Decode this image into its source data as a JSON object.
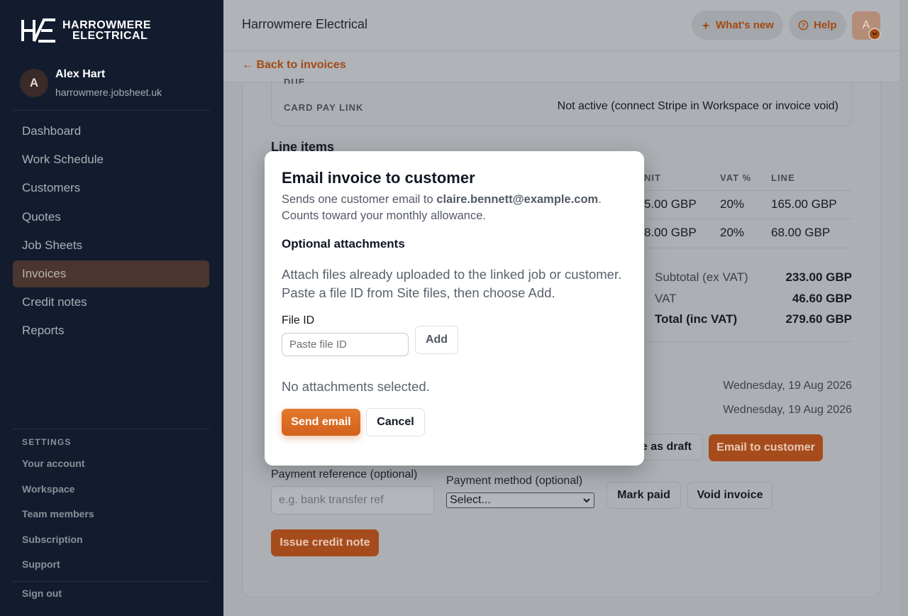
{
  "brand": {
    "line1": "HARROWMERE",
    "line2": "ELECTRICAL"
  },
  "user": {
    "initial": "A",
    "name": "Alex Hart",
    "host": "harrowmere.jobsheet.uk"
  },
  "nav": {
    "items": [
      {
        "label": "Dashboard"
      },
      {
        "label": "Work Schedule"
      },
      {
        "label": "Customers"
      },
      {
        "label": "Quotes"
      },
      {
        "label": "Job Sheets"
      },
      {
        "label": "Invoices",
        "active": true
      },
      {
        "label": "Credit notes"
      },
      {
        "label": "Reports"
      }
    ]
  },
  "settings": {
    "heading": "SETTINGS",
    "items": [
      {
        "label": "Your account"
      },
      {
        "label": "Workspace"
      },
      {
        "label": "Team members"
      },
      {
        "label": "Subscription"
      },
      {
        "label": "Support"
      }
    ],
    "signout": "Sign out"
  },
  "topbar": {
    "title": "Harrowmere Electrical",
    "whats_new": "What's new",
    "help": "Help",
    "avatar_initial": "A"
  },
  "back": {
    "label": "← Back to invoices"
  },
  "details": {
    "due_label": "DUE",
    "card_pay_label": "CARD PAY LINK",
    "card_pay_value": "Not active (connect Stripe in Workspace or invoice void)"
  },
  "line_items": {
    "heading": "Line items",
    "columns": {
      "unit": "NIT",
      "vat": "VAT %",
      "line": "LINE"
    },
    "rows": [
      {
        "unit": "5.00 GBP",
        "vat": "20%",
        "line": "165.00 GBP"
      },
      {
        "unit": "8.00 GBP",
        "vat": "20%",
        "line": "68.00 GBP"
      }
    ]
  },
  "totals": {
    "subtotal_label": "Subtotal (ex VAT)",
    "subtotal": "233.00 GBP",
    "vat_label": "VAT",
    "vat": "46.60 GBP",
    "total_label": "Total (inc VAT)",
    "total": "279.60 GBP"
  },
  "dates": {
    "date1": "Wednesday, 19 Aug 2026",
    "date2": "Wednesday, 19 Aug 2026"
  },
  "actions": {
    "save_draft": "e as draft",
    "email_customer": "Email to customer",
    "payment_ref_label": "Payment reference (optional)",
    "payment_ref_placeholder": "e.g. bank transfer ref",
    "payment_method_label": "Payment method (optional)",
    "payment_method_value": "Select...",
    "mark_paid": "Mark paid",
    "void_invoice": "Void invoice",
    "issue_credit": "Issue credit note"
  },
  "modal": {
    "title": "Email invoice to customer",
    "desc_prefix": "Sends one customer email to ",
    "email": "claire.bennett@example.com",
    "desc_suffix": ". Counts toward your monthly allowance.",
    "attachments_heading": "Optional attachments",
    "help_text": "Attach files already uploaded to the linked job or customer. Paste a file ID from Site files, then choose Add.",
    "file_id_label": "File ID",
    "file_id_placeholder": "Paste file ID",
    "add_label": "Add",
    "no_attachments": "No attachments selected.",
    "send_label": "Send email",
    "cancel_label": "Cancel"
  }
}
